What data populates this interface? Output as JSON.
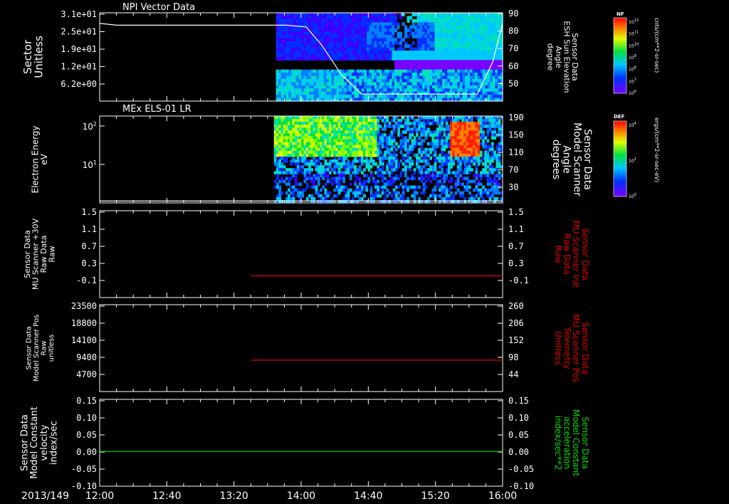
{
  "window": {
    "date_label": "2013/149"
  },
  "colors": {
    "axis": "#ffffff",
    "red_trace": "#e00000",
    "green_trace": "#00e000",
    "background": "#000000"
  },
  "chart_data": [
    {
      "type": "heatmap",
      "title": "NPI Vector Data",
      "ylabel": [
        "Sector",
        "Unitless"
      ],
      "yticks": [
        "3.1e+01",
        "2.5e+01",
        "1.9e+01",
        "1.2e+01",
        "6.2e+00"
      ],
      "ylim": [
        0,
        31
      ],
      "y2label": [
        "Sensor Data",
        "ESH Sun Elevation",
        "Angle",
        "degree"
      ],
      "y2ticks": [
        "90",
        "80",
        "70",
        "60",
        "50"
      ],
      "y2lim": [
        40,
        90
      ],
      "overlay_line": {
        "x_hours": [
          12.0,
          12.17,
          13.85,
          14.05,
          14.2,
          14.4,
          14.6,
          15.0,
          15.5,
          15.75,
          15.9,
          16.0
        ],
        "y": [
          84,
          83,
          83,
          82,
          72,
          55,
          44,
          44,
          44,
          44,
          62,
          84
        ]
      },
      "data_start_hour": 13.75,
      "colorbar": {
        "label": "NF",
        "units": "cnts/(cm**2-sr-sec)",
        "ticks": [
          "10^12",
          "10^11",
          "10^10",
          "10^9",
          "10^8",
          "10^7",
          "10^6"
        ]
      }
    },
    {
      "type": "heatmap",
      "title": "MEx ELS-01 LR",
      "ylabel": [
        "Electron Energy",
        "eV"
      ],
      "yticks": [
        "10^2",
        "10^1"
      ],
      "ylog": true,
      "y2label": [
        "Sensor Data",
        "Model Scanner",
        "Angle",
        "degrees"
      ],
      "y2ticks": [
        "190",
        "150",
        "110",
        "70",
        "30"
      ],
      "y2lim": [
        0,
        190
      ],
      "overlay_line": {
        "x_hours": [
          12.0,
          16.0
        ],
        "y": [
          4,
          4
        ]
      },
      "data_start_hour": 13.73,
      "colorbar": {
        "label": "DEF",
        "units": "ergs/(cm**2-sr-sec-eV)",
        "ticks": [
          "10^4",
          "10^2",
          "10^0"
        ]
      }
    },
    {
      "type": "line",
      "ylabel": [
        "Sensor Data",
        "MU Scanner +30V",
        "Raw Data",
        "Raw"
      ],
      "yticks": [
        "1.5",
        "1.1",
        "0.7",
        "0.3",
        "-0.1"
      ],
      "ylim": [
        -0.5,
        1.5
      ],
      "y2label": [
        "Sensor Data",
        "MU Scanner Init",
        "Raw Data",
        "Raw"
      ],
      "y2ticks": [
        "1.5",
        "1.1",
        "0.7",
        "0.3",
        "-0.1"
      ],
      "series": [
        {
          "x_hours": [
            13.5,
            16.0
          ],
          "values": [
            0.0,
            0.0
          ]
        }
      ]
    },
    {
      "type": "line",
      "ylabel": [
        "Sensor Data",
        "Model Scanner Pos",
        "Raw",
        "unitless"
      ],
      "yticks": [
        "23500",
        "18800",
        "14100",
        "9400",
        "4700"
      ],
      "ylim": [
        0,
        23500
      ],
      "y2label": [
        "Sensor Data",
        "MU Scanner Pos",
        "Telemetry",
        "Unitless"
      ],
      "y2ticks": [
        "260",
        "206",
        "152",
        "98",
        "44"
      ],
      "series": [
        {
          "x_hours": [
            13.5,
            16.0
          ],
          "values": [
            8500,
            8500
          ]
        }
      ]
    },
    {
      "type": "line",
      "ylabel": [
        "Sensor Data",
        "Model Constant",
        "velocity",
        "index/sec"
      ],
      "yticks": [
        "0.15",
        "0.10",
        "0.05",
        "0.00",
        "-0.05",
        "-0.10"
      ],
      "ylim": [
        -0.1,
        0.15
      ],
      "y2label": [
        "Sensor Data",
        "Model Constant",
        "acceleration",
        "index/sec**2"
      ],
      "y2ticks": [
        "0.15",
        "0.10",
        "0.05",
        "0.00",
        "-0.05",
        "-0.10"
      ],
      "series": [
        {
          "x_hours": [
            12.0,
            16.0
          ],
          "values": [
            0.0,
            0.0
          ]
        }
      ],
      "xticks": [
        "12:00",
        "12:40",
        "13:20",
        "14:00",
        "14:40",
        "15:20",
        "16:00"
      ],
      "xlim_hours": [
        12.0,
        16.0
      ]
    }
  ]
}
